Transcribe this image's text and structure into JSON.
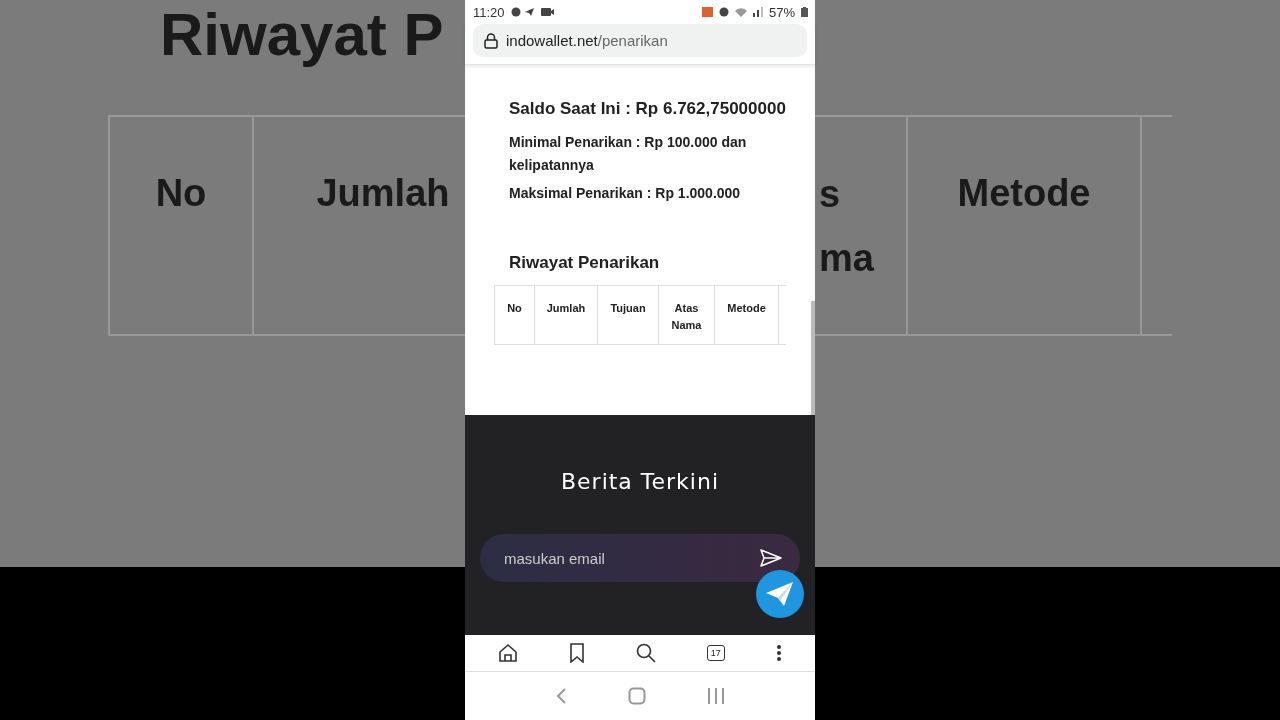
{
  "backdrop": {
    "heading": "Riwayat P",
    "columns_left": [
      "No",
      "Jumlah"
    ],
    "fragment_lines": [
      "s",
      "ma"
    ],
    "columns_right": [
      "Metode"
    ]
  },
  "status_bar": {
    "time": "11:20",
    "battery": "57%"
  },
  "address_bar": {
    "domain": "indowallet.net",
    "path": "/penarikan"
  },
  "info": {
    "balance": "Saldo Saat Ini : Rp 6.762,75000000",
    "minimum": "Minimal Penarikan : Rp 100.000 dan kelipatannya",
    "maximum": "Maksimal Penarikan : Rp 1.000.000"
  },
  "history": {
    "title": "Riwayat Penarikan",
    "columns": [
      "No",
      "Jumlah",
      "Tujuan",
      "Atas Nama",
      "Metode"
    ]
  },
  "footer": {
    "title": "Berita Terkini",
    "email": {
      "placeholder": "masukan email"
    }
  },
  "browser_toolbar": {
    "tab_count": "17"
  }
}
